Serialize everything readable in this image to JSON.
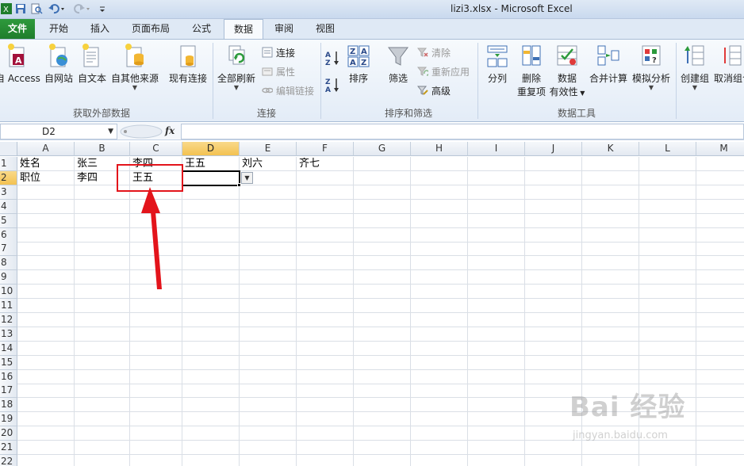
{
  "window": {
    "title": "lizi3.xlsx  -  Microsoft Excel"
  },
  "ribbon": {
    "tabs": [
      "文件",
      "开始",
      "插入",
      "页面布局",
      "公式",
      "数据",
      "审阅",
      "视图"
    ],
    "active_tab": "数据",
    "groups": {
      "get_external": {
        "label": "获取外部数据",
        "access": "自 Access",
        "web": "自网站",
        "text": "自文本",
        "other": "自其他来源",
        "existing": "现有连接"
      },
      "connections": {
        "label": "连接",
        "refresh_all": "全部刷新",
        "connections": "连接",
        "properties": "属性",
        "edit_links": "编辑链接"
      },
      "sort_filter": {
        "label": "排序和筛选",
        "sort": "排序",
        "filter": "筛选",
        "clear": "清除",
        "reapply": "重新应用",
        "advanced": "高级"
      },
      "data_tools": {
        "label": "数据工具",
        "text_to_columns": "分列",
        "remove_dup_1": "删除",
        "remove_dup_2": "重复项",
        "validation_1": "数据",
        "validation_2": "有效性",
        "consolidate": "合并计算",
        "whatif": "模拟分析"
      },
      "outline": {
        "group": "创建组",
        "ungroup": "取消组合"
      }
    }
  },
  "formula_bar": {
    "name_box": "D2",
    "fx_label": "fx",
    "value": ""
  },
  "sheet": {
    "columns": [
      "A",
      "B",
      "C",
      "D",
      "E",
      "F",
      "G",
      "H",
      "I",
      "J",
      "K",
      "L",
      "M"
    ],
    "selected_column": "D",
    "rows": [
      "1",
      "2",
      "3",
      "4",
      "5",
      "6",
      "7",
      "8",
      "9",
      "10",
      "11",
      "12",
      "13",
      "14",
      "15",
      "16",
      "17",
      "18",
      "19",
      "20",
      "21",
      "22"
    ],
    "selected_row": "2",
    "cells": {
      "A1": "姓名",
      "B1": "张三",
      "C1": "李四",
      "D1": "王五",
      "E1": "刘六",
      "F1": "齐七",
      "A2": "职位",
      "B2": "李四",
      "C2": "王五",
      "D2": ""
    }
  },
  "annotation": {
    "color": "#e3141b"
  },
  "watermark": {
    "logo": "Bai 经验",
    "url": "jingyan.baidu.com"
  }
}
